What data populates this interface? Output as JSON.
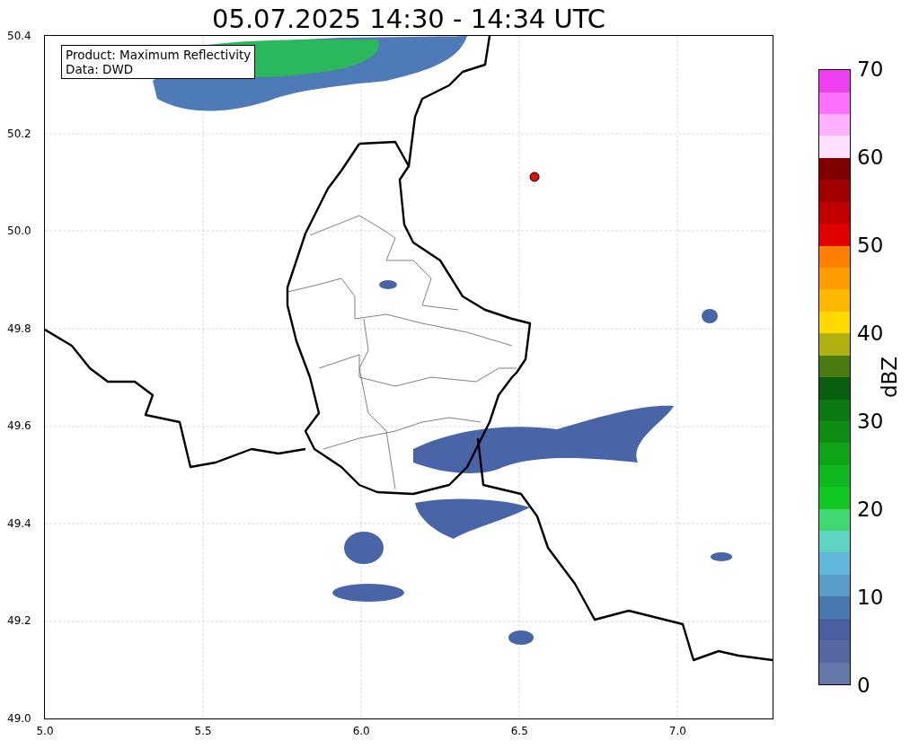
{
  "title": "05.07.2025 14:30 - 14:34 UTC",
  "annotation": [
    "Product: Maximum Reflectivity",
    "Data: DWD"
  ],
  "x_axis": {
    "ticks": [
      "5.0",
      "5.5",
      "6.0",
      "6.5",
      "7.0"
    ]
  },
  "y_axis": {
    "ticks": [
      "50.4",
      "50.2",
      "50.0",
      "49.8",
      "49.6",
      "49.4",
      "49.2",
      "49.0"
    ]
  },
  "colorbar": {
    "label": "dBZ",
    "ticks": [
      "70",
      "60",
      "50",
      "40",
      "30",
      "20",
      "10",
      "0"
    ],
    "bands": [
      {
        "color": "#6677aa"
      },
      {
        "color": "#5566a0"
      },
      {
        "color": "#4a5fa0"
      },
      {
        "color": "#4a78b0"
      },
      {
        "color": "#5a9cc8"
      },
      {
        "color": "#62b8dc"
      },
      {
        "color": "#5fd4c4"
      },
      {
        "color": "#40d870"
      },
      {
        "color": "#10c820"
      },
      {
        "color": "#10b820"
      },
      {
        "color": "#10a418"
      },
      {
        "color": "#0e8c14"
      },
      {
        "color": "#0c7814"
      },
      {
        "color": "#0a5e10"
      },
      {
        "color": "#4a7a10"
      },
      {
        "color": "#b0b010"
      },
      {
        "color": "#ffd800"
      },
      {
        "color": "#ffb800"
      },
      {
        "color": "#ff9c00"
      },
      {
        "color": "#ff8000"
      },
      {
        "color": "#e00000"
      },
      {
        "color": "#c00000"
      },
      {
        "color": "#a00000"
      },
      {
        "color": "#800000"
      },
      {
        "color": "#ffe0ff"
      },
      {
        "color": "#ffb0ff"
      },
      {
        "color": "#ff70ff"
      },
      {
        "color": "#ee40ee"
      }
    ]
  }
}
